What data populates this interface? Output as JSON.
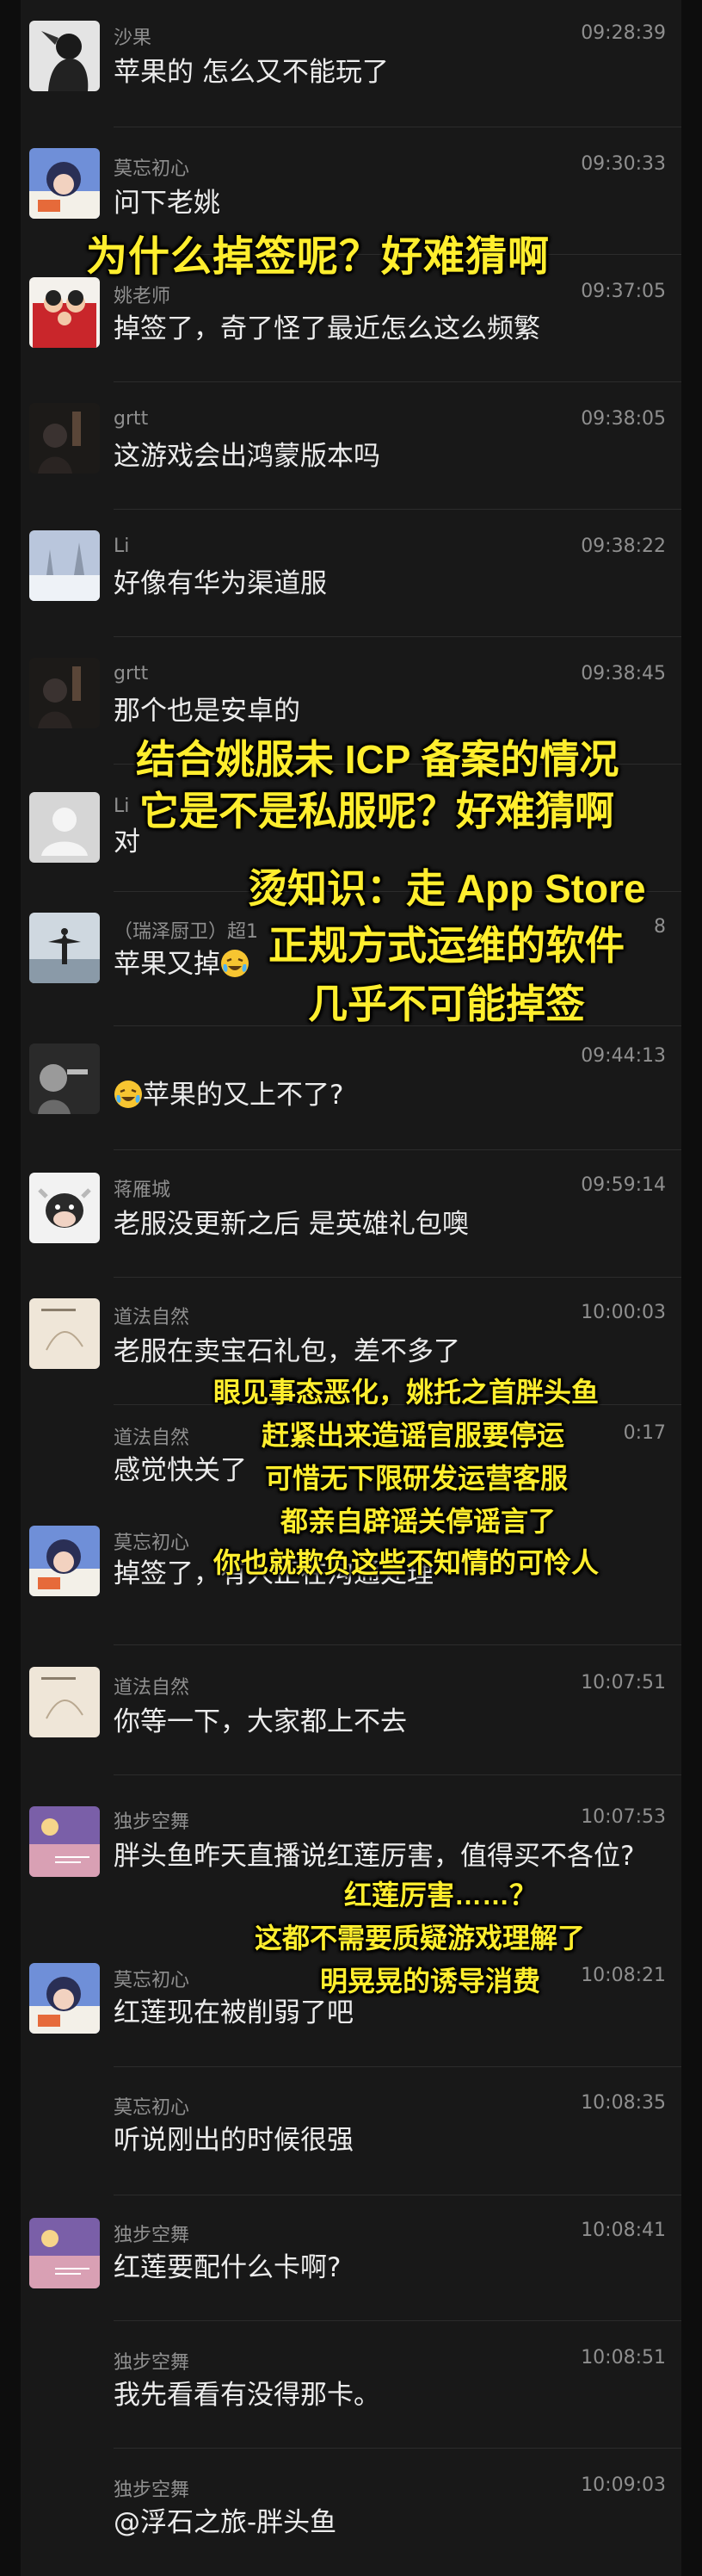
{
  "colors": {
    "background": "#181818",
    "caption": "#ffee2e",
    "name": "#8f8f8f",
    "text": "#ececec"
  },
  "messages": [
    {
      "name": "沙果",
      "time": "09:28:39",
      "text": "苹果的 怎么又不能玩了",
      "avatar": "anime-silhouette-avatar"
    },
    {
      "name": "莫忘初心",
      "time": "09:30:33",
      "text": "问下老姚",
      "avatar": "anime-girl-avatar"
    },
    {
      "name": "姚老师",
      "time": "09:37:05",
      "text": "掉签了，奇了怪了最近怎么这么频繁",
      "avatar": "red-family-photo-avatar"
    },
    {
      "name": "grtt",
      "time": "09:38:05",
      "text": "这游戏会出鸿蒙版本吗",
      "avatar": "dark-character-avatar"
    },
    {
      "name": "Li",
      "time": "09:38:22",
      "text": "好像有华为渠道服",
      "avatar": "snow-landscape-avatar"
    },
    {
      "name": "grtt",
      "time": "09:38:45",
      "text": "那个也是安卓的",
      "avatar": "dark-character-avatar"
    },
    {
      "name": "Li",
      "time": "",
      "text": "对",
      "avatar": "default-person-avatar"
    },
    {
      "name": "（瑞泽厨卫）超1",
      "time": "8",
      "text": "苹果又掉",
      "avatar": "beach-silhouette-avatar",
      "emoji": true
    },
    {
      "name": "",
      "time": "09:44:13",
      "text": "苹果的又上不了?",
      "avatar": "grayscale-portrait-avatar",
      "emoji": true
    },
    {
      "name": "蒋雁城",
      "time": "09:59:14",
      "text": "老服没更新之后 是英雄礼包噢",
      "avatar": "cow-cartoon-avatar"
    },
    {
      "name": "道法自然",
      "time": "10:00:03",
      "text": "老服在卖宝石礼包，差不多了",
      "avatar": "paper-art-avatar"
    },
    {
      "name": "道法自然",
      "time": "0:17",
      "text": "感觉快关了",
      "avatar": "none"
    },
    {
      "name": "莫忘初心",
      "time": "",
      "text": "掉签了，有人正在沟通处理",
      "avatar": "anime-girl-avatar"
    },
    {
      "name": "道法自然",
      "time": "10:07:51",
      "text": "你等一下，大家都上不去",
      "avatar": "paper-art-avatar"
    },
    {
      "name": "独步空舞",
      "time": "10:07:53",
      "text": "胖头鱼昨天直播说红莲厉害，值得买不各位?",
      "avatar": "moon-sunset-avatar"
    },
    {
      "name": "莫忘初心",
      "time": "10:08:21",
      "text": "红莲现在被削弱了吧",
      "avatar": "anime-girl-avatar"
    },
    {
      "name": "莫忘初心",
      "time": "10:08:35",
      "text": "听说刚出的时候很强",
      "avatar": "none"
    },
    {
      "name": "独步空舞",
      "time": "10:08:41",
      "text": "红莲要配什么卡啊?",
      "avatar": "moon-sunset-avatar"
    },
    {
      "name": "独步空舞",
      "time": "10:08:51",
      "text": "我先看看有没得那卡。",
      "avatar": "none"
    },
    {
      "name": "独步空舞",
      "time": "10:09:03",
      "text": "@浮石之旅-胖头鱼",
      "avatar": "none"
    }
  ],
  "captions": {
    "c1": "为什么掉签呢？好难猜啊",
    "c2a": "结合姚服未 ICP 备案的情况",
    "c2b": "它是不是私服呢？好难猜啊",
    "c3a": "烫知识：走 App Store",
    "c3b": "正规方式运维的软件",
    "c3c": "几乎不可能掉签",
    "c4a": "眼见事态恶化，姚托之首胖头鱼",
    "c4b": "赶紧出来造谣官服要停运",
    "c4c": "可惜无下限研发运营客服",
    "c4d": "都亲自辟谣关停谣言了",
    "c4e": "你也就欺负这些不知情的可怜人",
    "c5a": "红莲厉害……？",
    "c5b": "这都不需要质疑游戏理解了",
    "c5c": "明晃晃的诱导消费"
  }
}
